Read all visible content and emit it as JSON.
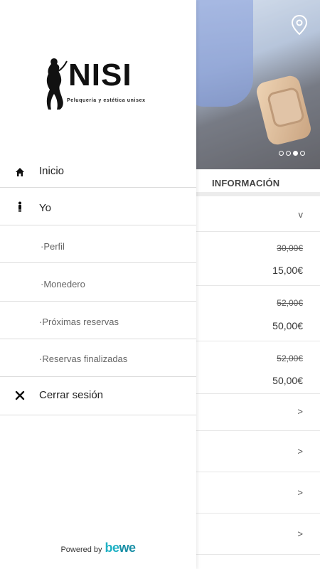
{
  "drawer": {
    "logo": {
      "name": "NISI",
      "subtitle": "Peluquería y estética unisex"
    },
    "menu": [
      {
        "label": "Inicio",
        "icon": "home-icon"
      },
      {
        "label": "Yo",
        "icon": "person-icon"
      },
      {
        "label": "·Perfil"
      },
      {
        "label": "·Monedero"
      },
      {
        "label": "·Próximas reservas"
      },
      {
        "label": "·Reservas finalizadas"
      },
      {
        "label": "Cerrar sesión",
        "icon": "close-icon"
      }
    ],
    "powered_by": {
      "text": "Powered by",
      "brand_a": "be",
      "brand_b": "we"
    }
  },
  "page": {
    "section_title": "INFORMACIÓN",
    "expand_glyph": "v",
    "prices": [
      {
        "old": "30,00€",
        "new": "15,00€"
      },
      {
        "old": "52,00€",
        "new": "50,00€"
      },
      {
        "old": "52,00€",
        "new": "50,00€"
      }
    ],
    "chevron": ">",
    "carousel": {
      "total": 4,
      "active": 2
    }
  },
  "colors": {
    "brand_teal": "#1fb1c4",
    "brand_teal_dark": "#1a8fa6",
    "divider": "#dcdcdc"
  }
}
